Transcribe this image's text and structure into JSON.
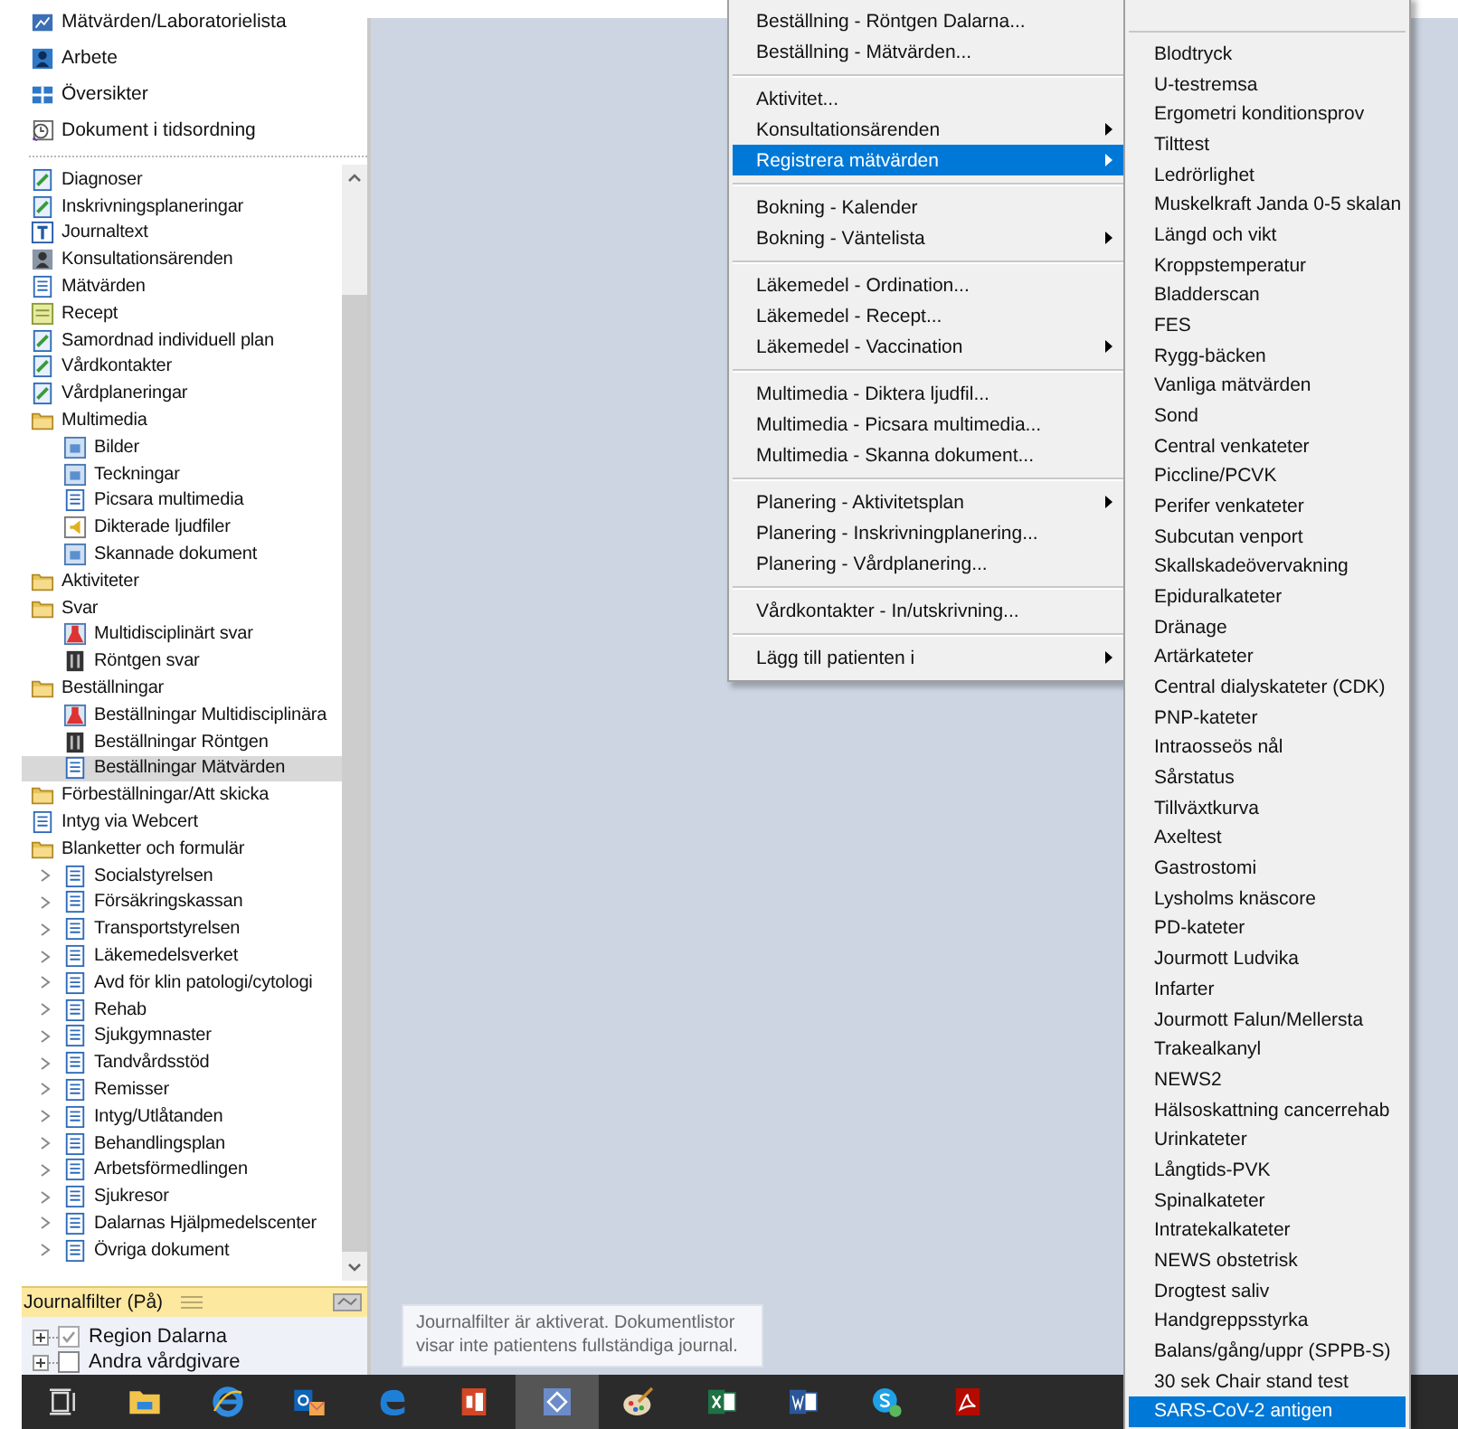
{
  "sidebar": {
    "nav": [
      {
        "label": "Mätvärden/Laboratorielista",
        "kind": "chart"
      },
      {
        "label": "Arbete",
        "kind": "person"
      },
      {
        "label": "Översikter",
        "kind": "grid"
      },
      {
        "label": "Dokument i tidsordning",
        "kind": "clock"
      }
    ],
    "tree": [
      {
        "label": "Diagnoser",
        "kind": "page",
        "selected": false
      },
      {
        "label": "Inskrivningsplaneringar",
        "kind": "page",
        "selected": false
      },
      {
        "label": "Journaltext",
        "kind": "text",
        "selected": false
      },
      {
        "label": "Konsultationsärenden",
        "kind": "person",
        "selected": false
      },
      {
        "label": "Mätvärden",
        "kind": "form",
        "selected": false
      },
      {
        "label": "Recept",
        "kind": "note",
        "selected": false
      },
      {
        "label": "Samordnad individuell plan",
        "kind": "page",
        "selected": false
      },
      {
        "label": "Vårdkontakter",
        "kind": "page",
        "selected": false
      },
      {
        "label": "Vårdplaneringar",
        "kind": "page",
        "selected": false
      },
      {
        "label": "Multimedia",
        "kind": "folder",
        "selected": false,
        "children": [
          {
            "label": "Bilder",
            "kind": "image",
            "selected": false
          },
          {
            "label": "Teckningar",
            "kind": "image",
            "selected": false
          },
          {
            "label": "Picsara multimedia",
            "kind": "form",
            "selected": false
          },
          {
            "label": "Dikterade ljudfiler",
            "kind": "audio",
            "selected": false
          },
          {
            "label": "Skannade dokument",
            "kind": "image",
            "selected": false
          }
        ]
      },
      {
        "label": "Aktiviteter",
        "kind": "folder",
        "selected": false
      },
      {
        "label": "Svar",
        "kind": "folder",
        "selected": false,
        "children": [
          {
            "label": "Multidisciplinärt svar",
            "kind": "flask",
            "selected": false
          },
          {
            "label": "Röntgen svar",
            "kind": "xray",
            "selected": false
          }
        ]
      },
      {
        "label": "Beställningar",
        "kind": "folder",
        "selected": false,
        "children": [
          {
            "label": "Beställningar Multidisciplinära",
            "kind": "flask",
            "selected": false
          },
          {
            "label": "Beställningar Röntgen",
            "kind": "xray",
            "selected": false
          },
          {
            "label": "Beställningar Mätvärden",
            "kind": "form",
            "selected": true
          }
        ]
      },
      {
        "label": "Förbeställningar/Att skicka",
        "kind": "folder",
        "selected": false
      },
      {
        "label": "Intyg via Webcert",
        "kind": "form",
        "selected": false
      },
      {
        "label": "Blanketter och formulär",
        "kind": "folder",
        "selected": false,
        "children": [
          {
            "label": "Socialstyrelsen",
            "kind": "form",
            "selected": false,
            "expanded": false
          },
          {
            "label": "Försäkringskassan",
            "kind": "form",
            "selected": false,
            "expanded": false
          },
          {
            "label": "Transportstyrelsen",
            "kind": "form",
            "selected": false,
            "expanded": false
          },
          {
            "label": "Läkemedelsverket",
            "kind": "form",
            "selected": false,
            "expanded": false
          },
          {
            "label": "Avd för klin patologi/cytologi",
            "kind": "form",
            "selected": false,
            "expanded": false
          },
          {
            "label": "Rehab",
            "kind": "form",
            "selected": false,
            "expanded": false
          },
          {
            "label": "Sjukgymnaster",
            "kind": "form",
            "selected": false,
            "expanded": false
          },
          {
            "label": "Tandvårdsstöd",
            "kind": "form",
            "selected": false,
            "expanded": false
          },
          {
            "label": "Remisser",
            "kind": "form",
            "selected": false,
            "expanded": false
          },
          {
            "label": "Intyg/Utlåtanden",
            "kind": "form",
            "selected": false,
            "expanded": false
          },
          {
            "label": "Behandlingsplan",
            "kind": "form",
            "selected": false,
            "expanded": false
          },
          {
            "label": "Arbetsförmedlingen",
            "kind": "form",
            "selected": false,
            "expanded": false
          },
          {
            "label": "Sjukresor",
            "kind": "form",
            "selected": false,
            "expanded": false
          },
          {
            "label": "Dalarnas Hjälpmedelscenter",
            "kind": "form",
            "selected": false,
            "expanded": false
          },
          {
            "label": "Övriga dokument",
            "kind": "form",
            "selected": false,
            "expanded": false
          }
        ]
      }
    ],
    "filter": {
      "title": "Journalfilter (På)",
      "items": [
        {
          "label": "Region Dalarna",
          "checked": true
        },
        {
          "label": "Andra vårdgivare",
          "checked": false
        }
      ]
    }
  },
  "context_menu": {
    "groups": [
      [
        {
          "label": "Beställning - Röntgen Dalarna...",
          "submenu": false,
          "selected": false
        },
        {
          "label": "Beställning - Mätvärden...",
          "submenu": false,
          "selected": false
        }
      ],
      [
        {
          "label": "Aktivitet...",
          "submenu": false,
          "selected": false
        },
        {
          "label": "Konsultationsärenden",
          "submenu": true,
          "selected": false
        },
        {
          "label": "Registrera mätvärden",
          "submenu": true,
          "selected": true
        }
      ],
      [
        {
          "label": "Bokning - Kalender",
          "submenu": false,
          "selected": false
        },
        {
          "label": "Bokning - Väntelista",
          "submenu": true,
          "selected": false
        }
      ],
      [
        {
          "label": "Läkemedel - Ordination...",
          "submenu": false,
          "selected": false
        },
        {
          "label": "Läkemedel - Recept...",
          "submenu": false,
          "selected": false
        },
        {
          "label": "Läkemedel - Vaccination",
          "submenu": true,
          "selected": false
        }
      ],
      [
        {
          "label": "Multimedia - Diktera ljudfil...",
          "submenu": false,
          "selected": false
        },
        {
          "label": "Multimedia - Picsara multimedia...",
          "submenu": false,
          "selected": false
        },
        {
          "label": "Multimedia - Skanna dokument...",
          "submenu": false,
          "selected": false
        }
      ],
      [
        {
          "label": "Planering - Aktivitetsplan",
          "submenu": true,
          "selected": false
        },
        {
          "label": "Planering - Inskrivningplanering...",
          "submenu": false,
          "selected": false
        },
        {
          "label": "Planering - Vårdplanering...",
          "submenu": false,
          "selected": false
        }
      ],
      [
        {
          "label": "Vårdkontakter - In/utskrivning...",
          "submenu": false,
          "selected": false
        }
      ],
      [
        {
          "label": "Lägg till patienten i",
          "submenu": true,
          "selected": false
        }
      ]
    ]
  },
  "submenu": {
    "items": [
      {
        "label": "Blodtryck",
        "selected": false
      },
      {
        "label": "U-testremsa",
        "selected": false
      },
      {
        "label": "Ergometri konditionsprov",
        "selected": false
      },
      {
        "label": "Tilttest",
        "selected": false
      },
      {
        "label": "Ledrörlighet",
        "selected": false
      },
      {
        "label": "Muskelkraft Janda 0-5 skalan",
        "selected": false
      },
      {
        "label": "Längd och vikt",
        "selected": false
      },
      {
        "label": "Kroppstemperatur",
        "selected": false
      },
      {
        "label": "Bladderscan",
        "selected": false
      },
      {
        "label": "FES",
        "selected": false
      },
      {
        "label": "Rygg-bäcken",
        "selected": false
      },
      {
        "label": "Vanliga mätvärden",
        "selected": false
      },
      {
        "label": "Sond",
        "selected": false
      },
      {
        "label": "Central venkateter",
        "selected": false
      },
      {
        "label": "Piccline/PCVK",
        "selected": false
      },
      {
        "label": "Perifer venkateter",
        "selected": false
      },
      {
        "label": "Subcutan venport",
        "selected": false
      },
      {
        "label": "Skallskadeövervakning",
        "selected": false
      },
      {
        "label": "Epiduralkateter",
        "selected": false
      },
      {
        "label": "Dränage",
        "selected": false
      },
      {
        "label": "Artärkateter",
        "selected": false
      },
      {
        "label": "Central dialyskateter (CDK)",
        "selected": false
      },
      {
        "label": "PNP-kateter",
        "selected": false
      },
      {
        "label": "Intraosseös nål",
        "selected": false
      },
      {
        "label": "Sårstatus",
        "selected": false
      },
      {
        "label": "Tillväxtkurva",
        "selected": false
      },
      {
        "label": "Axeltest",
        "selected": false
      },
      {
        "label": "Gastrostomi",
        "selected": false
      },
      {
        "label": "Lysholms knäscore",
        "selected": false
      },
      {
        "label": "PD-kateter",
        "selected": false
      },
      {
        "label": "Jourmott Ludvika",
        "selected": false
      },
      {
        "label": "Infarter",
        "selected": false
      },
      {
        "label": "Jourmott Falun/Mellersta",
        "selected": false
      },
      {
        "label": "Trakealkanyl",
        "selected": false
      },
      {
        "label": "NEWS2",
        "selected": false
      },
      {
        "label": "Hälsoskattning cancerrehab",
        "selected": false
      },
      {
        "label": "Urinkateter",
        "selected": false
      },
      {
        "label": "Långtids-PVK",
        "selected": false
      },
      {
        "label": "Spinalkateter",
        "selected": false
      },
      {
        "label": "Intratekalkateter",
        "selected": false
      },
      {
        "label": "NEWS obstetrisk",
        "selected": false
      },
      {
        "label": "Drogtest saliv",
        "selected": false
      },
      {
        "label": "Handgreppsstyrka",
        "selected": false
      },
      {
        "label": "Balans/gång/uppr (SPPB-S)",
        "selected": false
      },
      {
        "label": "30 sek Chair stand test",
        "selected": false
      },
      {
        "label": "SARS-CoV-2 antigen",
        "selected": true
      }
    ]
  },
  "tooltip": {
    "text": "Journalfilter är aktiverat. Dokumentlistor visar inte patientens fullständiga journal."
  },
  "taskbar": {
    "apps": [
      {
        "kind": "taskview",
        "selected": false
      },
      {
        "kind": "explorer",
        "selected": false
      },
      {
        "kind": "ie",
        "selected": false
      },
      {
        "kind": "outlook",
        "selected": false
      },
      {
        "kind": "edge",
        "selected": false
      },
      {
        "kind": "powerpoint",
        "selected": false
      },
      {
        "kind": "app",
        "selected": true
      },
      {
        "kind": "paint",
        "selected": false
      },
      {
        "kind": "excel",
        "selected": false
      },
      {
        "kind": "word",
        "selected": false
      },
      {
        "kind": "skype",
        "selected": false
      },
      {
        "kind": "acrobat",
        "selected": false
      }
    ]
  }
}
